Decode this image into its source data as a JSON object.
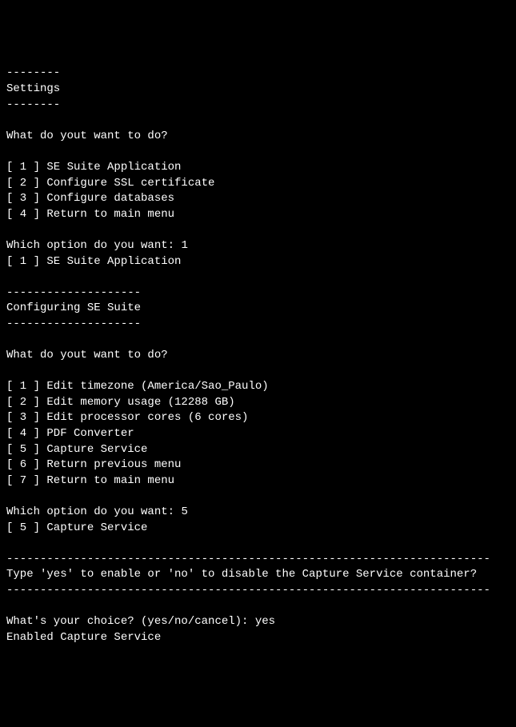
{
  "divider_short": "--------",
  "settings_title": "Settings",
  "prompt_title": "What do yout want to do?",
  "settings_menu": {
    "item1": "[ 1 ] SE Suite Application",
    "item2": "[ 2 ] Configure SSL certificate",
    "item3": "[ 3 ] Configure databases",
    "item4": "[ 4 ] Return to main menu"
  },
  "option_prompt": "Which option do you want: ",
  "first_choice": "1",
  "first_echo": "[ 1 ] SE Suite Application",
  "divider_medium": "--------------------",
  "config_title": "Configuring SE Suite",
  "config_menu": {
    "item1": "[ 1 ] Edit timezone (America/Sao_Paulo)",
    "item2": "[ 2 ] Edit memory usage (12288 GB)",
    "item3": "[ 3 ] Edit processor cores (6 cores)",
    "item4": "[ 4 ] PDF Converter",
    "item5": "[ 5 ] Capture Service",
    "item6": "[ 6 ] Return previous menu",
    "item7": "[ 7 ] Return to main menu"
  },
  "second_choice": "5",
  "second_echo": "[ 5 ] Capture Service",
  "divider_long": "------------------------------------------------------------------------",
  "enable_prompt": "Type 'yes' to enable or 'no' to disable the Capture Service container?",
  "choice_prompt": "What's your choice? (yes/no/cancel): ",
  "choice_answer": "yes",
  "result": "Enabled Capture Service"
}
